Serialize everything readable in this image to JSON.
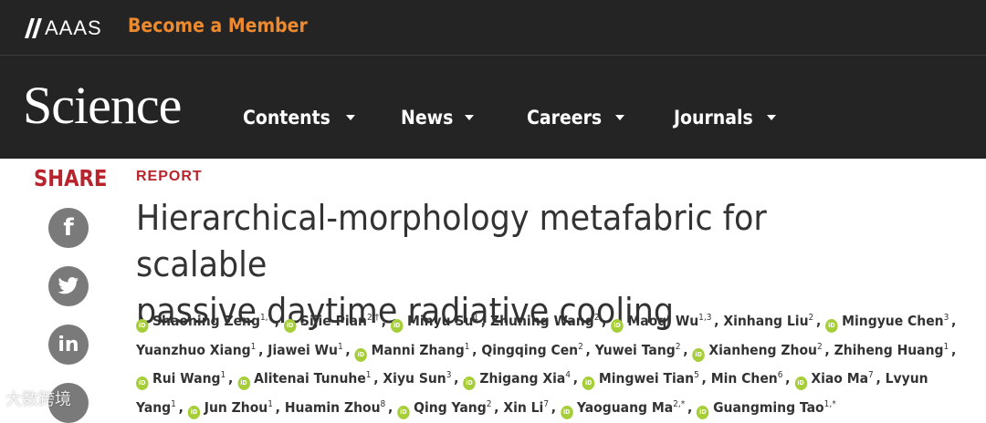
{
  "aaas_bar": {
    "logo_text": "AAAS",
    "member_link": "Become a Member",
    "accent_color": "#ed8a2f"
  },
  "nav": {
    "logo": "Science",
    "items": [
      {
        "label": "Contents",
        "icon": "chevron-down-icon"
      },
      {
        "label": "News",
        "icon": "chevron-down-icon"
      },
      {
        "label": "Careers",
        "icon": "chevron-down-icon"
      },
      {
        "label": "Journals",
        "icon": "chevron-down-icon"
      }
    ]
  },
  "share": {
    "label": "SHARE",
    "buttons": [
      {
        "name": "facebook-icon",
        "glyph": "f"
      },
      {
        "name": "twitter-icon",
        "glyph": "🐦"
      },
      {
        "name": "linkedin-icon",
        "glyph": "in"
      },
      {
        "name": "share-more-icon",
        "glyph": ""
      }
    ],
    "accent_color": "#b9232c"
  },
  "article": {
    "type_label": "REPORT",
    "title_line1": "Hierarchical-morphology metafabric for scalable",
    "title_line2": "passive daytime radiative cooling",
    "orcid_badge": "iD",
    "authors": [
      {
        "name": "Shaoning Zeng",
        "sup": "1,†",
        "orcid": true
      },
      {
        "name": "Sijie Pian",
        "sup": "2,†",
        "orcid": true
      },
      {
        "name": "Minyu Su",
        "sup": "1",
        "orcid": true
      },
      {
        "name": "Zhuning Wang",
        "sup": "2",
        "orcid": false
      },
      {
        "name": "Maoqi Wu",
        "sup": "1,3",
        "orcid": true
      },
      {
        "name": "Xinhang Liu",
        "sup": "2",
        "orcid": false
      },
      {
        "name": "Mingyue Chen",
        "sup": "3",
        "orcid": true
      },
      {
        "name": "Yuanzhuo Xiang",
        "sup": "1",
        "orcid": false
      },
      {
        "name": "Jiawei Wu",
        "sup": "1",
        "orcid": false
      },
      {
        "name": "Manni Zhang",
        "sup": "1",
        "orcid": true
      },
      {
        "name": "Qingqing Cen",
        "sup": "2",
        "orcid": false
      },
      {
        "name": "Yuwei Tang",
        "sup": "2",
        "orcid": false
      },
      {
        "name": "Xianheng Zhou",
        "sup": "2",
        "orcid": true
      },
      {
        "name": "Zhiheng Huang",
        "sup": "1",
        "orcid": false
      },
      {
        "name": "Rui Wang",
        "sup": "1",
        "orcid": true
      },
      {
        "name": "Alitenai Tunuhe",
        "sup": "1",
        "orcid": true
      },
      {
        "name": "Xiyu Sun",
        "sup": "3",
        "orcid": false
      },
      {
        "name": "Zhigang Xia",
        "sup": "4",
        "orcid": true
      },
      {
        "name": "Mingwei Tian",
        "sup": "5",
        "orcid": true
      },
      {
        "name": "Min Chen",
        "sup": "6",
        "orcid": false
      },
      {
        "name": "Xiao Ma",
        "sup": "7",
        "orcid": true
      },
      {
        "name": "Lvyun Yang",
        "sup": "1",
        "orcid": false
      },
      {
        "name": "Jun Zhou",
        "sup": "1",
        "orcid": true
      },
      {
        "name": "Huamin Zhou",
        "sup": "8",
        "orcid": false
      },
      {
        "name": "Qing Yang",
        "sup": "2",
        "orcid": true
      },
      {
        "name": "Xin Li",
        "sup": "7",
        "orcid": false
      },
      {
        "name": "Yaoguang Ma",
        "sup": "2,*",
        "orcid": true
      },
      {
        "name": "Guangming Tao",
        "sup": "1,*",
        "orcid": true
      }
    ]
  },
  "watermark": "大数跨境"
}
